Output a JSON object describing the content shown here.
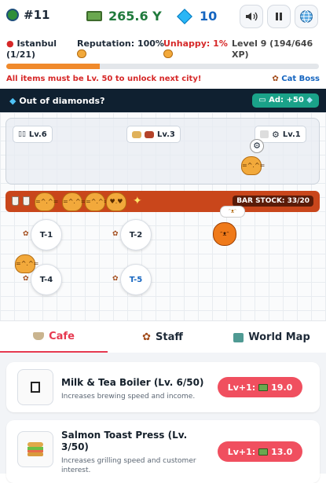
{
  "header": {
    "rank": "#11",
    "money": "265.6 Y",
    "diamonds": "10"
  },
  "status": {
    "city_label": "Istanbul",
    "city_progress": "(1/21)",
    "reputation": "Reputation: 100%",
    "unhappy": "Unhappy: 1%",
    "level_line1": "Level 9 (194/646",
    "level_line2": "XP)",
    "xp_progress": 0.3,
    "unlock_notice": "All items must be Lv. 50 to unlock next city!",
    "cat_boss": "Cat Boss"
  },
  "diamond_banner": {
    "text": "Out of diamonds?",
    "ad_button": "Ad: +50"
  },
  "stations": [
    {
      "level": "Lv.6"
    },
    {
      "level": "Lv.3"
    },
    {
      "level": "Lv.1"
    }
  ],
  "bar": {
    "stock": "BAR STOCK: 33/20"
  },
  "tables": [
    "T-1",
    "T-2",
    "T-4",
    "T-5"
  ],
  "tabs": [
    {
      "label": "Cafe"
    },
    {
      "label": "Staff"
    },
    {
      "label": "World Map"
    }
  ],
  "upgrades": [
    {
      "title": "Milk & Tea Boiler (Lv. 6/50)",
      "description": "Increases brewing speed and income.",
      "button_label": "Lv+1:",
      "cost": "19.0"
    },
    {
      "title_line1": "Salmon Toast Press (Lv.",
      "title_line2": "3/50)",
      "description_line1": "Increases grilling speed and customer",
      "description_line2": "interest.",
      "button_label": "Lv+1:",
      "cost": "13.0"
    }
  ],
  "colors": {
    "accent": "#e63950",
    "orange": "#f08a2c",
    "bar": "#c9461b",
    "dark": "#0f2030"
  }
}
